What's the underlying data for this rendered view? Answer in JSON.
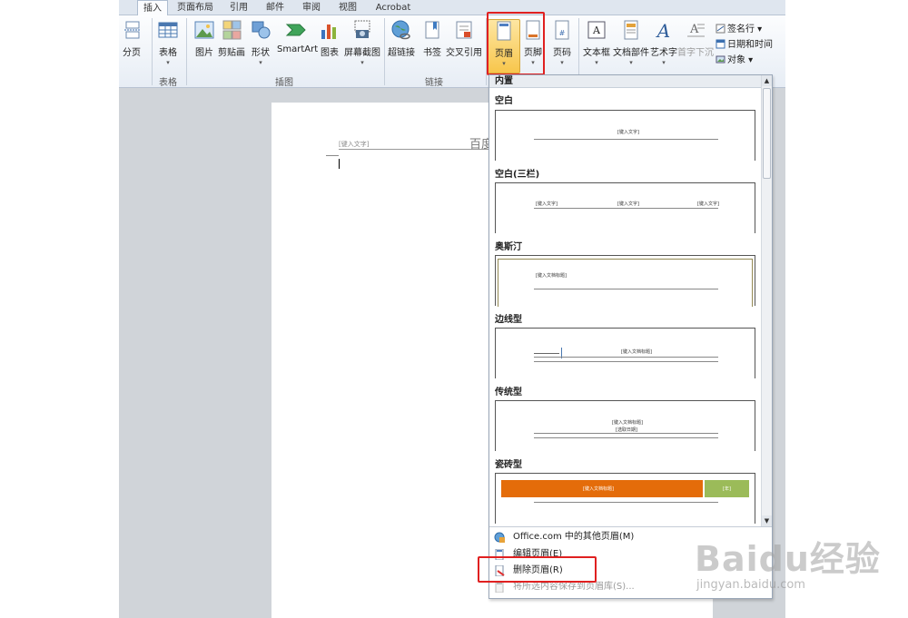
{
  "tabs": {
    "items": [
      "插入",
      "页面布局",
      "引用",
      "邮件",
      "审阅",
      "视图",
      "Acrobat"
    ],
    "active": "插入"
  },
  "ribbon": {
    "page_break": "分页",
    "table": "表格",
    "picture": "图片",
    "clipart": "剪贴画",
    "shapes": "形状",
    "smartart": "SmartArt",
    "chart": "图表",
    "screenshot": "屏幕截图",
    "hyperlink": "超链接",
    "bookmark": "书签",
    "crossref": "交叉引用",
    "header": "页眉",
    "footer": "页脚",
    "page_number": "页码",
    "textbox": "文本框",
    "quickparts": "文档部件",
    "wordart": "艺术字",
    "dropcap": "首字下沉",
    "signature_line": "签名行 ▾",
    "datetime": "日期和时间",
    "object": "对象 ▾",
    "group_table": "表格",
    "group_illustrations": "插图",
    "group_links": "链接",
    "dropdown_arrow": "▾"
  },
  "document": {
    "header_placeholder": "[键入文字]",
    "header_big_text": "百度"
  },
  "dropdown": {
    "section_label": "内置",
    "templates": [
      {
        "title": "空白",
        "thumb_texts": [
          "[键入文字]"
        ]
      },
      {
        "title": "空白(三栏)",
        "thumb_texts": [
          "[键入文字]",
          "[键入文字]",
          "[键入文字]"
        ]
      },
      {
        "title": "奥斯汀",
        "thumb_texts": [
          "[键入文档标题]"
        ]
      },
      {
        "title": "边线型",
        "thumb_texts": [
          "[键入文档标题]"
        ]
      },
      {
        "title": "传统型",
        "thumb_texts": [
          "[键入文档标题]",
          "[选取日期]"
        ]
      },
      {
        "title": "瓷砖型",
        "thumb_texts": [
          "[键入文档标题]",
          "[年]"
        ]
      }
    ],
    "menu": [
      {
        "label": "Office.com 中的其他页眉(M)",
        "disabled": false
      },
      {
        "label": "编辑页眉(E)",
        "disabled": false
      },
      {
        "label": "删除页眉(R)",
        "disabled": false
      },
      {
        "label": "将所选内容保存到页眉库(S)...",
        "disabled": true
      }
    ]
  },
  "watermark": {
    "brand": "Baidu经验",
    "url": "jingyan.baidu.com"
  },
  "colors": {
    "highlight": "#e02020",
    "tile_orange": "#e46c0a",
    "tile_green": "#9bbb59",
    "austin_border": "#938953"
  }
}
